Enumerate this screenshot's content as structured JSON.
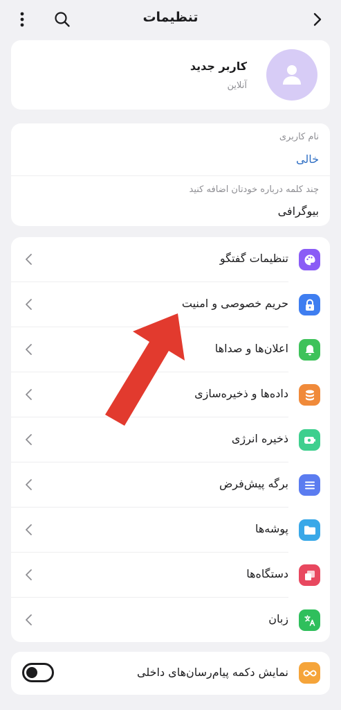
{
  "header": {
    "title": "تنظیمات",
    "icons": [
      "more-vert-icon",
      "search-icon",
      "chevron-right-icon"
    ]
  },
  "profile": {
    "name": "کاربر جدید",
    "status": "آنلاین",
    "avatar_color": "#d7ccf6"
  },
  "account": {
    "username_label": "نام کاربری",
    "username_value": "خالی",
    "bio_hint": "چند کلمه درباره خودتان اضافه کنید",
    "bio_label": "بیوگرافی"
  },
  "settings": {
    "items": [
      {
        "label": "تنظیمات گفتگو",
        "icon": "palette-icon",
        "color": "#8a5cf6"
      },
      {
        "label": "حریم خصوصی و امنیت",
        "icon": "lock-icon",
        "color": "#3f7ef0"
      },
      {
        "label": "اعلان‌ها و صداها",
        "icon": "bell-icon",
        "color": "#3ec25a"
      },
      {
        "label": "داده‌ها و ذخیره‌سازی",
        "icon": "database-icon",
        "color": "#f08a3a"
      },
      {
        "label": "ذخیره انرژی",
        "icon": "battery-icon",
        "color": "#3ecf8e"
      },
      {
        "label": "برگه پیش‌فرض",
        "icon": "list-icon",
        "color": "#5b7cf0"
      },
      {
        "label": "پوشه‌ها",
        "icon": "folder-icon",
        "color": "#39a8e8"
      },
      {
        "label": "دستگاه‌ها",
        "icon": "devices-icon",
        "color": "#e8485f"
      },
      {
        "label": "زبان",
        "icon": "translate-icon",
        "color": "#2fbf5c"
      }
    ]
  },
  "inner_messenger": {
    "label": "نمایش دکمه پیام‌رسان‌های داخلی",
    "icon": "infinity-icon",
    "color": "#f5a43a",
    "enabled": false
  },
  "annotation": {
    "arrow_color": "#e23a2e"
  }
}
